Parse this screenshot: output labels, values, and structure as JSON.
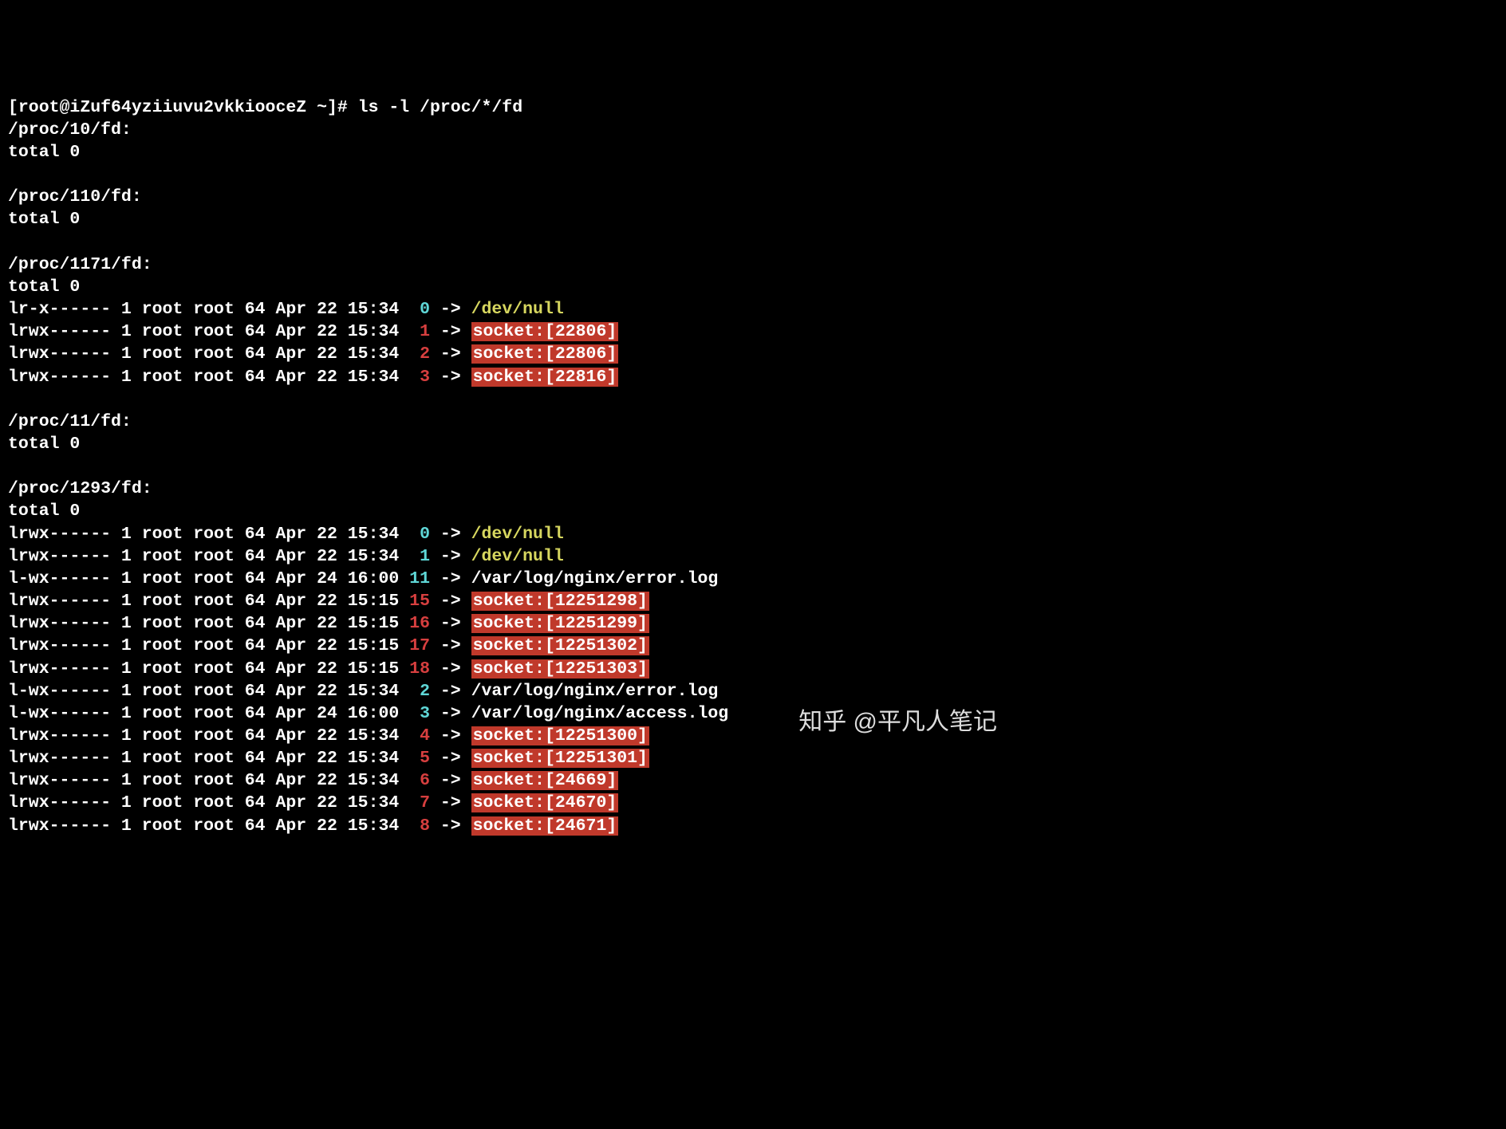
{
  "prompt": "[root@iZuf64yziiuvu2vkkiooceZ ~]# ls -l /proc/*/fd",
  "watermark": "知乎 @平凡人笔记",
  "colors": {
    "fd_cyan": "#5fd7d7",
    "fd_red": "#d73f3f",
    "target_yellow": "#d7d75f",
    "socket_bg": "#c0392b"
  },
  "blocks": [
    {
      "header": "/proc/10/fd:",
      "total": "total 0",
      "entries": []
    },
    {
      "header": "/proc/110/fd:",
      "total": "total 0",
      "entries": []
    },
    {
      "header": "/proc/1171/fd:",
      "total": "total 0",
      "entries": [
        {
          "perms": "lr-x------",
          "links": "1",
          "owner": "root",
          "group": "root",
          "size": "64",
          "date": "Apr 22 15:34",
          "fd": "0",
          "fd_color": "cyan",
          "target": "/dev/null",
          "target_style": "yellow"
        },
        {
          "perms": "lrwx------",
          "links": "1",
          "owner": "root",
          "group": "root",
          "size": "64",
          "date": "Apr 22 15:34",
          "fd": "1",
          "fd_color": "red",
          "target": "socket:[22806]",
          "target_style": "socket"
        },
        {
          "perms": "lrwx------",
          "links": "1",
          "owner": "root",
          "group": "root",
          "size": "64",
          "date": "Apr 22 15:34",
          "fd": "2",
          "fd_color": "red",
          "target": "socket:[22806]",
          "target_style": "socket"
        },
        {
          "perms": "lrwx------",
          "links": "1",
          "owner": "root",
          "group": "root",
          "size": "64",
          "date": "Apr 22 15:34",
          "fd": "3",
          "fd_color": "red",
          "target": "socket:[22816]",
          "target_style": "socket"
        }
      ]
    },
    {
      "header": "/proc/11/fd:",
      "total": "total 0",
      "entries": []
    },
    {
      "header": "/proc/1293/fd:",
      "total": "total 0",
      "entries": [
        {
          "perms": "lrwx------",
          "links": "1",
          "owner": "root",
          "group": "root",
          "size": "64",
          "date": "Apr 22 15:34",
          "fd": "0",
          "fd_color": "cyan",
          "target": "/dev/null",
          "target_style": "yellow"
        },
        {
          "perms": "lrwx------",
          "links": "1",
          "owner": "root",
          "group": "root",
          "size": "64",
          "date": "Apr 22 15:34",
          "fd": "1",
          "fd_color": "cyan",
          "target": "/dev/null",
          "target_style": "yellow"
        },
        {
          "perms": "l-wx------",
          "links": "1",
          "owner": "root",
          "group": "root",
          "size": "64",
          "date": "Apr 24 16:00",
          "fd": "11",
          "fd_color": "cyan",
          "target": "/var/log/nginx/error.log",
          "target_style": "plain"
        },
        {
          "perms": "lrwx------",
          "links": "1",
          "owner": "root",
          "group": "root",
          "size": "64",
          "date": "Apr 22 15:15",
          "fd": "15",
          "fd_color": "red",
          "target": "socket:[12251298]",
          "target_style": "socket"
        },
        {
          "perms": "lrwx------",
          "links": "1",
          "owner": "root",
          "group": "root",
          "size": "64",
          "date": "Apr 22 15:15",
          "fd": "16",
          "fd_color": "red",
          "target": "socket:[12251299]",
          "target_style": "socket"
        },
        {
          "perms": "lrwx------",
          "links": "1",
          "owner": "root",
          "group": "root",
          "size": "64",
          "date": "Apr 22 15:15",
          "fd": "17",
          "fd_color": "red",
          "target": "socket:[12251302]",
          "target_style": "socket"
        },
        {
          "perms": "lrwx------",
          "links": "1",
          "owner": "root",
          "group": "root",
          "size": "64",
          "date": "Apr 22 15:15",
          "fd": "18",
          "fd_color": "red",
          "target": "socket:[12251303]",
          "target_style": "socket"
        },
        {
          "perms": "l-wx------",
          "links": "1",
          "owner": "root",
          "group": "root",
          "size": "64",
          "date": "Apr 22 15:34",
          "fd": "2",
          "fd_color": "cyan",
          "target": "/var/log/nginx/error.log",
          "target_style": "plain"
        },
        {
          "perms": "l-wx------",
          "links": "1",
          "owner": "root",
          "group": "root",
          "size": "64",
          "date": "Apr 24 16:00",
          "fd": "3",
          "fd_color": "cyan",
          "target": "/var/log/nginx/access.log",
          "target_style": "plain"
        },
        {
          "perms": "lrwx------",
          "links": "1",
          "owner": "root",
          "group": "root",
          "size": "64",
          "date": "Apr 22 15:34",
          "fd": "4",
          "fd_color": "red",
          "target": "socket:[12251300]",
          "target_style": "socket"
        },
        {
          "perms": "lrwx------",
          "links": "1",
          "owner": "root",
          "group": "root",
          "size": "64",
          "date": "Apr 22 15:34",
          "fd": "5",
          "fd_color": "red",
          "target": "socket:[12251301]",
          "target_style": "socket"
        },
        {
          "perms": "lrwx------",
          "links": "1",
          "owner": "root",
          "group": "root",
          "size": "64",
          "date": "Apr 22 15:34",
          "fd": "6",
          "fd_color": "red",
          "target": "socket:[24669]",
          "target_style": "socket"
        },
        {
          "perms": "lrwx------",
          "links": "1",
          "owner": "root",
          "group": "root",
          "size": "64",
          "date": "Apr 22 15:34",
          "fd": "7",
          "fd_color": "red",
          "target": "socket:[24670]",
          "target_style": "socket"
        },
        {
          "perms": "lrwx------",
          "links": "1",
          "owner": "root",
          "group": "root",
          "size": "64",
          "date": "Apr 22 15:34",
          "fd": "8",
          "fd_color": "red",
          "target": "socket:[24671]",
          "target_style": "socket"
        }
      ]
    }
  ]
}
